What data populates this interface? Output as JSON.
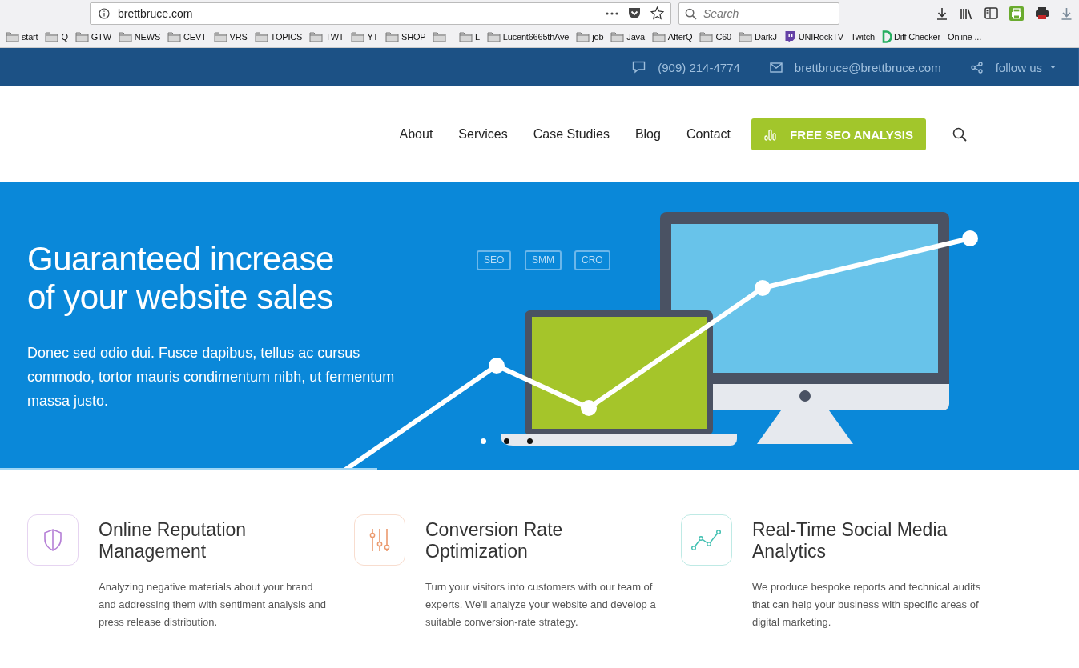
{
  "browser": {
    "url": "brettbruce.com",
    "search_placeholder": "Search",
    "bookmarks": [
      {
        "label": "start",
        "kind": "folder"
      },
      {
        "label": "Q",
        "kind": "folder"
      },
      {
        "label": "GTW",
        "kind": "folder"
      },
      {
        "label": "NEWS",
        "kind": "folder"
      },
      {
        "label": "CEVT",
        "kind": "folder"
      },
      {
        "label": "VRS",
        "kind": "folder"
      },
      {
        "label": "TOPICS",
        "kind": "folder"
      },
      {
        "label": "TWT",
        "kind": "folder"
      },
      {
        "label": "YT",
        "kind": "folder"
      },
      {
        "label": "SHOP",
        "kind": "folder"
      },
      {
        "label": "-",
        "kind": "folder"
      },
      {
        "label": "L",
        "kind": "folder"
      },
      {
        "label": "Lucent6665thAve",
        "kind": "folder"
      },
      {
        "label": "job",
        "kind": "folder"
      },
      {
        "label": "Java",
        "kind": "folder"
      },
      {
        "label": "AfterQ",
        "kind": "folder"
      },
      {
        "label": "C60",
        "kind": "folder"
      },
      {
        "label": "DarkJ",
        "kind": "folder"
      },
      {
        "label": "UNIRockTV - Twitch",
        "kind": "twitch"
      },
      {
        "label": "Diff Checker - Online ...",
        "kind": "diff"
      }
    ]
  },
  "top_bar": {
    "phone": "(909) 214-4774",
    "email": "brettbruce@brettbruce.com",
    "follow": "follow us"
  },
  "nav": {
    "items": [
      "About",
      "Services",
      "Case Studies",
      "Blog",
      "Contact"
    ],
    "cta": "FREE SEO ANALYSIS"
  },
  "hero": {
    "title": "Guaranteed increase of your website sales",
    "text": "Donec sed odio dui. Fusce dapibus, tellus ac cursus commodo, tortor mauris condimentum nibh, ut fermentum massa justo.",
    "tags": [
      "SEO",
      "SMM",
      "CRO"
    ],
    "slides": [
      {
        "selected": true
      },
      {
        "selected": false
      },
      {
        "selected": false
      }
    ],
    "progress": {
      "level": 0.35
    }
  },
  "features": [
    {
      "kind": "shield",
      "color": "#b57fd6",
      "title": "Online Reputation Management",
      "text": "Analyzing negative materials about your brand and addressing them with sentiment analysis and press release distribution."
    },
    {
      "kind": "sliders",
      "color": "#eb9a6e",
      "title": "Conversion Rate Optimization",
      "text": "Turn your visitors into customers with our team of experts. We'll analyze your website and develop a suitable conversion-rate strategy."
    },
    {
      "kind": "chart",
      "color": "#3fbfb0",
      "title": "Real-Time Social Media Analytics",
      "text": "We produce bespoke reports and technical audits that can help your business with specific areas of digital marketing."
    }
  ]
}
